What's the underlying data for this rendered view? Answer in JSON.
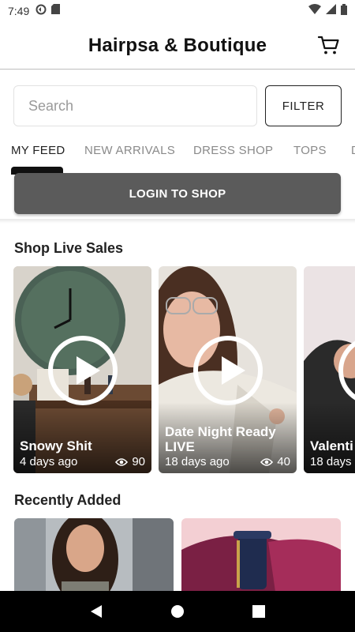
{
  "status": {
    "time": "7:49"
  },
  "header": {
    "title": "Hairpsa & Boutique"
  },
  "search": {
    "placeholder": "Search",
    "filter_label": "FILTER"
  },
  "tabs": [
    {
      "label": "MY FEED",
      "active": true
    },
    {
      "label": "NEW ARRIVALS",
      "active": false
    },
    {
      "label": "DRESS SHOP",
      "active": false
    },
    {
      "label": "TOPS",
      "active": false
    },
    {
      "label": "D",
      "active": false
    }
  ],
  "login": {
    "label": "LOGIN TO SHOP"
  },
  "live": {
    "title": "Shop Live Sales",
    "cards": [
      {
        "title": "Snowy Shit",
        "meta": "4 days ago",
        "views": "90"
      },
      {
        "title": "Date Night Ready LIVE",
        "meta": "18 days ago",
        "views": "40"
      },
      {
        "title": "Valenti",
        "meta": "18 days"
      }
    ]
  },
  "recent": {
    "title": "Recently Added"
  },
  "colors": {
    "accent": "#111111",
    "login_bg": "#5b5b5b"
  }
}
